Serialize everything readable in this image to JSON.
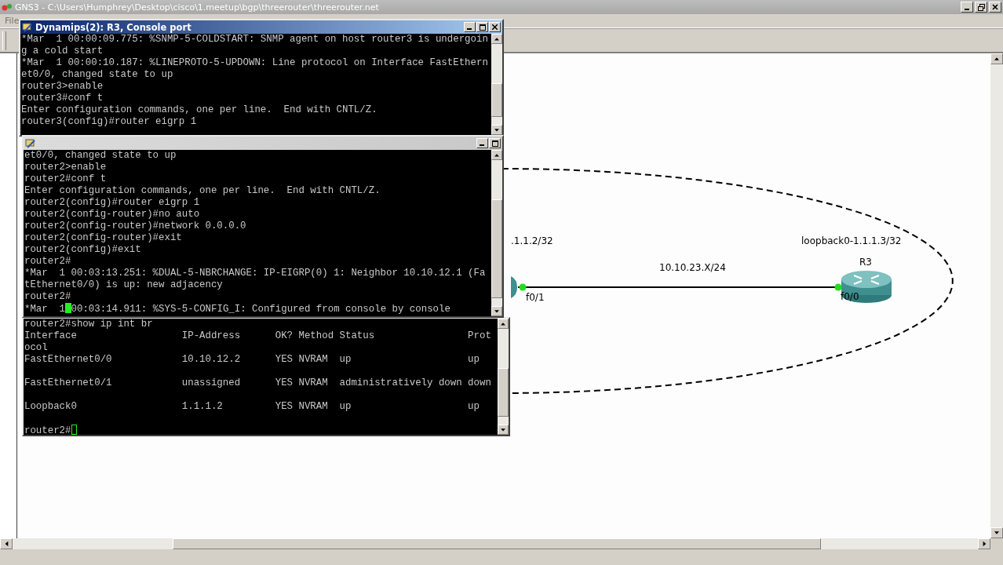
{
  "window": {
    "title": "GNS3 - C:\\Users\\Humphrey\\Desktop\\cisco\\1.meetup\\bgp\\threerouter\\threerouter.net"
  },
  "menu": [
    "File"
  ],
  "consoles": [
    {
      "title": "Dynamips(2): R3, Console port",
      "active": true,
      "lines": [
        {
          "kind": "text",
          "text": "*Mar  1 00:00:09.775: %SNMP-5-COLDSTART: SNMP agent on host router3 is undergoin"
        },
        {
          "kind": "text",
          "text": "g a cold start"
        },
        {
          "kind": "text",
          "text": "*Mar  1 00:00:10.187: %LINEPROTO-5-UPDOWN: Line protocol on Interface FastEthern"
        },
        {
          "kind": "text",
          "text": "et0/0, changed state to up"
        },
        {
          "kind": "text",
          "text": "router3>enable"
        },
        {
          "kind": "text",
          "text": "router3#conf t"
        },
        {
          "kind": "text",
          "text": "Enter configuration commands, one per line.  End with CNTL/Z."
        },
        {
          "kind": "text",
          "text": "router3(config)#router eigrp 1"
        }
      ]
    },
    {
      "active": false,
      "lines": [
        {
          "kind": "text",
          "text": "et0/0, changed state to up"
        },
        {
          "kind": "text",
          "text": "router2>enable"
        },
        {
          "kind": "text",
          "text": "router2#conf t"
        },
        {
          "kind": "text",
          "text": "Enter configuration commands, one per line.  End with CNTL/Z."
        },
        {
          "kind": "text",
          "text": "router2(config)#router eigrp 1"
        },
        {
          "kind": "text",
          "text": "router2(config-router)#no auto"
        },
        {
          "kind": "text",
          "text": "router2(config-router)#network 0.0.0.0"
        },
        {
          "kind": "text",
          "text": "router2(config-router)#exit"
        },
        {
          "kind": "text",
          "text": "router2(config)#exit"
        },
        {
          "kind": "text",
          "text": "router2#"
        },
        {
          "kind": "text",
          "text": "*Mar  1 00:03:13.251: %DUAL-5-NBRCHANGE: IP-EIGRP(0) 1: Neighbor 10.10.12.1 (Fa"
        },
        {
          "kind": "text",
          "text": "tEthernet0/0) is up: new adjacency"
        },
        {
          "kind": "text",
          "text": "router2#"
        },
        {
          "kind": "cursor",
          "text": "*Mar  1",
          "filled": true,
          "after": "00:03:14.911: %SYS-5-CONFIG_I: Configured from console by console"
        }
      ]
    },
    {
      "lines": [
        {
          "kind": "text",
          "text": "router2#show ip int br"
        },
        {
          "kind": "text",
          "text": "Interface                  IP-Address      OK? Method Status                Prot"
        },
        {
          "kind": "text",
          "text": "ocol"
        },
        {
          "kind": "text",
          "text": "FastEthernet0/0            10.10.12.2      YES NVRAM  up                    up"
        },
        {
          "kind": "blank"
        },
        {
          "kind": "text",
          "text": "FastEthernet0/1            unassigned      YES NVRAM  administratively down down"
        },
        {
          "kind": "blank"
        },
        {
          "kind": "text",
          "text": "Loopback0                  1.1.1.2         YES NVRAM  up                    up"
        },
        {
          "kind": "blank"
        },
        {
          "kind": "cursor",
          "text": "router2#",
          "filled": false
        }
      ]
    }
  ],
  "topology": {
    "node_label": "R3",
    "loopback_labels": [
      ".1.1.2/32",
      "loopback0-1.1.1.3/32"
    ],
    "link": {
      "label": "10.10.23.X/24",
      "ports": [
        "f0/1",
        "f0/0"
      ]
    }
  }
}
